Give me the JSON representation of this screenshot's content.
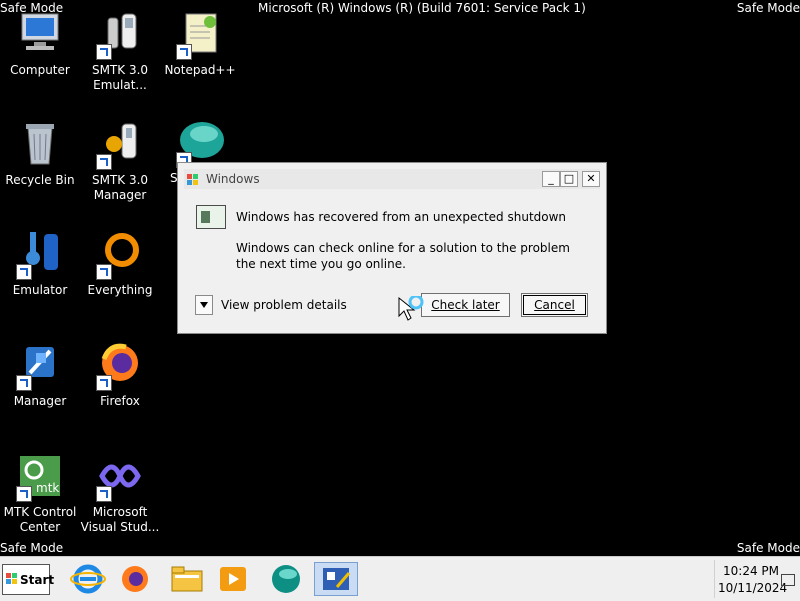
{
  "screen": {
    "safe_mode_label": "Safe Mode",
    "build_text": "Microsoft (R) Windows (R) (Build 7601: Service Pack 1)"
  },
  "desktop_icons": [
    {
      "label": "Computer",
      "icon": "computer-icon"
    },
    {
      "label": "SMTK 3.0 Emulat...",
      "icon": "smtk-emulator-icon"
    },
    {
      "label": "Notepad++",
      "icon": "notepad-plus-plus-icon"
    },
    {
      "label": "Recycle Bin",
      "icon": "recycle-bin-icon"
    },
    {
      "label": "SMTK 3.0 Manager",
      "icon": "smtk-manager-icon"
    },
    {
      "label": "Emulator",
      "icon": "emulator-icon"
    },
    {
      "label": "Everything",
      "icon": "everything-icon"
    },
    {
      "label": "Manager",
      "icon": "manager-icon"
    },
    {
      "label": "Firefox",
      "icon": "firefox-icon"
    },
    {
      "label": "MTK Control Center",
      "icon": "mtk-control-center-icon"
    },
    {
      "label": "Microsoft Visual Stud...",
      "icon": "visual-studio-icon"
    },
    {
      "label": "S",
      "icon": "partially-hidden-app-icon"
    }
  ],
  "dialog": {
    "title": "Windows",
    "min_glyph": "_",
    "max_glyph": "□",
    "close_glyph": "✕",
    "message_main": "Windows has recovered from an unexpected shutdown",
    "message_sub": "Windows can check online for a solution to the problem the next time you go online.",
    "details_label": "View problem details",
    "check_later_label": "Check later",
    "cancel_label": "Cancel"
  },
  "taskbar": {
    "start_label": "Start",
    "pinned": [
      "internet-explorer-icon",
      "firefox-icon",
      "file-explorer-icon",
      "media-player-icon",
      "edge-icon",
      "active-app-icon"
    ]
  },
  "tray": {
    "time": "10:24 PM",
    "date": "10/11/2024"
  },
  "colors": {
    "desktop_bg": "#000000",
    "dialog_bg": "#f0f0f0",
    "taskbar_bg": "#efefef"
  }
}
